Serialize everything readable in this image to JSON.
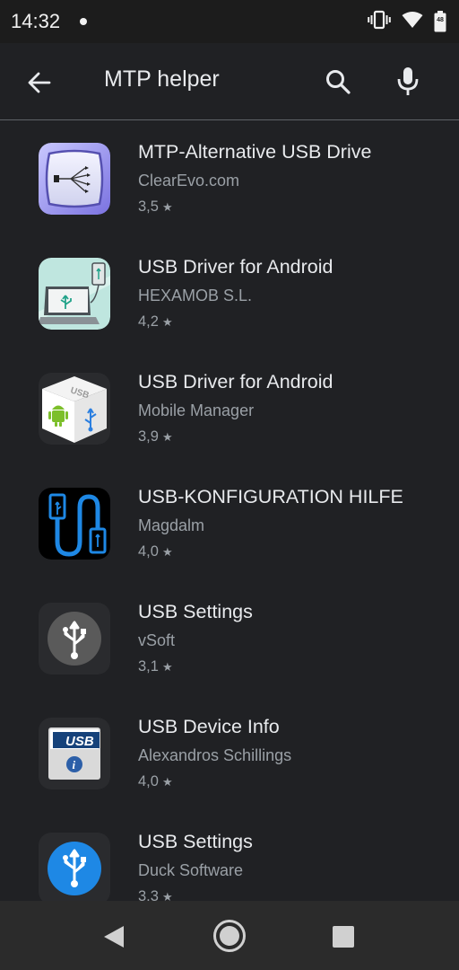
{
  "status_bar": {
    "time": "14:32",
    "battery_level": "48"
  },
  "search": {
    "query": "MTP helper"
  },
  "results": [
    {
      "title": "MTP-Alternative USB Drive",
      "developer": "ClearEvo.com",
      "rating": "3,5",
      "icon": "usb-drive-icon"
    },
    {
      "title": "USB Driver for Android",
      "developer": "HEXAMOB S.L.",
      "rating": "4,2",
      "icon": "laptop-usb-icon"
    },
    {
      "title": "USB Driver for Android",
      "developer": "Mobile Manager",
      "rating": "3,9",
      "icon": "usb-cube-icon"
    },
    {
      "title": "USB-KONFIGURATION HILFE",
      "developer": "Magdalm",
      "rating": "4,0",
      "icon": "usb-cable-icon"
    },
    {
      "title": "USB Settings",
      "developer": "vSoft",
      "rating": "3,1",
      "icon": "usb-symbol-icon"
    },
    {
      "title": "USB Device Info",
      "developer": "Alexandros Schillings",
      "rating": "4,0",
      "icon": "usb-info-icon"
    },
    {
      "title": "USB Settings",
      "developer": "Duck Software",
      "rating": "3,3",
      "icon": "usb-settings-icon"
    }
  ],
  "colors": {
    "background": "#202124",
    "text_primary": "#e8eaed",
    "text_secondary": "#9aa0a6",
    "nav_bar": "#2b2b2b"
  }
}
